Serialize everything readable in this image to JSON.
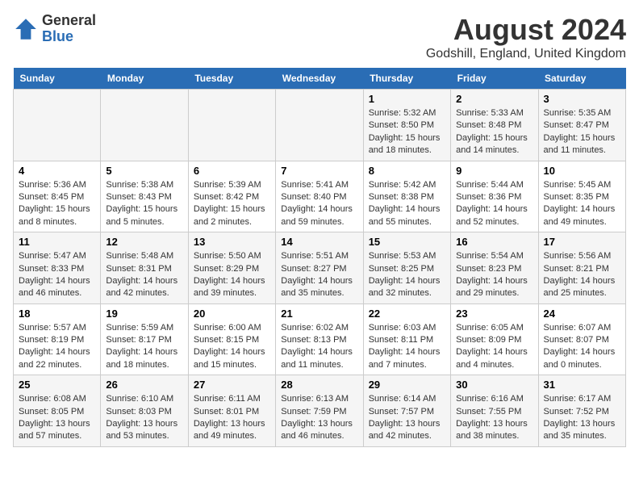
{
  "logo": {
    "general": "General",
    "blue": "Blue"
  },
  "title": "August 2024",
  "subtitle": "Godshill, England, United Kingdom",
  "headers": [
    "Sunday",
    "Monday",
    "Tuesday",
    "Wednesday",
    "Thursday",
    "Friday",
    "Saturday"
  ],
  "weeks": [
    [
      {
        "day": "",
        "info": ""
      },
      {
        "day": "",
        "info": ""
      },
      {
        "day": "",
        "info": ""
      },
      {
        "day": "",
        "info": ""
      },
      {
        "day": "1",
        "info": "Sunrise: 5:32 AM\nSunset: 8:50 PM\nDaylight: 15 hours and 18 minutes."
      },
      {
        "day": "2",
        "info": "Sunrise: 5:33 AM\nSunset: 8:48 PM\nDaylight: 15 hours and 14 minutes."
      },
      {
        "day": "3",
        "info": "Sunrise: 5:35 AM\nSunset: 8:47 PM\nDaylight: 15 hours and 11 minutes."
      }
    ],
    [
      {
        "day": "4",
        "info": "Sunrise: 5:36 AM\nSunset: 8:45 PM\nDaylight: 15 hours and 8 minutes."
      },
      {
        "day": "5",
        "info": "Sunrise: 5:38 AM\nSunset: 8:43 PM\nDaylight: 15 hours and 5 minutes."
      },
      {
        "day": "6",
        "info": "Sunrise: 5:39 AM\nSunset: 8:42 PM\nDaylight: 15 hours and 2 minutes."
      },
      {
        "day": "7",
        "info": "Sunrise: 5:41 AM\nSunset: 8:40 PM\nDaylight: 14 hours and 59 minutes."
      },
      {
        "day": "8",
        "info": "Sunrise: 5:42 AM\nSunset: 8:38 PM\nDaylight: 14 hours and 55 minutes."
      },
      {
        "day": "9",
        "info": "Sunrise: 5:44 AM\nSunset: 8:36 PM\nDaylight: 14 hours and 52 minutes."
      },
      {
        "day": "10",
        "info": "Sunrise: 5:45 AM\nSunset: 8:35 PM\nDaylight: 14 hours and 49 minutes."
      }
    ],
    [
      {
        "day": "11",
        "info": "Sunrise: 5:47 AM\nSunset: 8:33 PM\nDaylight: 14 hours and 46 minutes."
      },
      {
        "day": "12",
        "info": "Sunrise: 5:48 AM\nSunset: 8:31 PM\nDaylight: 14 hours and 42 minutes."
      },
      {
        "day": "13",
        "info": "Sunrise: 5:50 AM\nSunset: 8:29 PM\nDaylight: 14 hours and 39 minutes."
      },
      {
        "day": "14",
        "info": "Sunrise: 5:51 AM\nSunset: 8:27 PM\nDaylight: 14 hours and 35 minutes."
      },
      {
        "day": "15",
        "info": "Sunrise: 5:53 AM\nSunset: 8:25 PM\nDaylight: 14 hours and 32 minutes."
      },
      {
        "day": "16",
        "info": "Sunrise: 5:54 AM\nSunset: 8:23 PM\nDaylight: 14 hours and 29 minutes."
      },
      {
        "day": "17",
        "info": "Sunrise: 5:56 AM\nSunset: 8:21 PM\nDaylight: 14 hours and 25 minutes."
      }
    ],
    [
      {
        "day": "18",
        "info": "Sunrise: 5:57 AM\nSunset: 8:19 PM\nDaylight: 14 hours and 22 minutes."
      },
      {
        "day": "19",
        "info": "Sunrise: 5:59 AM\nSunset: 8:17 PM\nDaylight: 14 hours and 18 minutes."
      },
      {
        "day": "20",
        "info": "Sunrise: 6:00 AM\nSunset: 8:15 PM\nDaylight: 14 hours and 15 minutes."
      },
      {
        "day": "21",
        "info": "Sunrise: 6:02 AM\nSunset: 8:13 PM\nDaylight: 14 hours and 11 minutes."
      },
      {
        "day": "22",
        "info": "Sunrise: 6:03 AM\nSunset: 8:11 PM\nDaylight: 14 hours and 7 minutes."
      },
      {
        "day": "23",
        "info": "Sunrise: 6:05 AM\nSunset: 8:09 PM\nDaylight: 14 hours and 4 minutes."
      },
      {
        "day": "24",
        "info": "Sunrise: 6:07 AM\nSunset: 8:07 PM\nDaylight: 14 hours and 0 minutes."
      }
    ],
    [
      {
        "day": "25",
        "info": "Sunrise: 6:08 AM\nSunset: 8:05 PM\nDaylight: 13 hours and 57 minutes."
      },
      {
        "day": "26",
        "info": "Sunrise: 6:10 AM\nSunset: 8:03 PM\nDaylight: 13 hours and 53 minutes."
      },
      {
        "day": "27",
        "info": "Sunrise: 6:11 AM\nSunset: 8:01 PM\nDaylight: 13 hours and 49 minutes."
      },
      {
        "day": "28",
        "info": "Sunrise: 6:13 AM\nSunset: 7:59 PM\nDaylight: 13 hours and 46 minutes."
      },
      {
        "day": "29",
        "info": "Sunrise: 6:14 AM\nSunset: 7:57 PM\nDaylight: 13 hours and 42 minutes."
      },
      {
        "day": "30",
        "info": "Sunrise: 6:16 AM\nSunset: 7:55 PM\nDaylight: 13 hours and 38 minutes."
      },
      {
        "day": "31",
        "info": "Sunrise: 6:17 AM\nSunset: 7:52 PM\nDaylight: 13 hours and 35 minutes."
      }
    ]
  ]
}
